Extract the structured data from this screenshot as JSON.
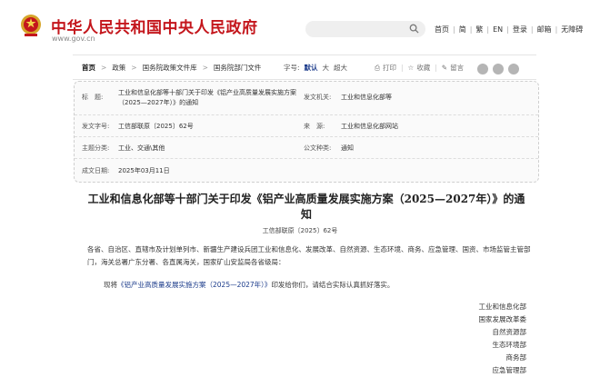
{
  "header": {
    "site_title": "中华人民共和国中央人民政府",
    "site_url": "www.gov.cn",
    "search_placeholder": "",
    "links": [
      "首页",
      "简",
      "繁",
      "EN",
      "登录",
      "邮箱",
      "无障碍"
    ]
  },
  "nav": {
    "breadcrumbs": [
      "首页",
      "政策",
      "国务院政策文件库",
      "国务院部门文件"
    ],
    "font_size_label": "字号:",
    "font_sizes": [
      "默认",
      "大",
      "超大"
    ],
    "tools": [
      "打印",
      "收藏",
      "留言"
    ]
  },
  "meta": {
    "title_label": "标　题:",
    "title_value": "工业和信息化部等十部门关于印发《铝产业高质量发展实施方案（2025—2027年）》的通知",
    "issuer_label": "发文机关:",
    "issuer_value": "工业和信息化部等",
    "doc_no_label": "发文字号:",
    "doc_no_value": "工信部联原〔2025〕62号",
    "source_label": "来　源:",
    "source_value": "工业和信息化部网站",
    "category_label": "主题分类:",
    "category_value": "工业、交通\\其他",
    "type_label": "公文种类:",
    "type_value": "通知",
    "date_label": "成文日期:",
    "date_value": "2025年03月11日"
  },
  "doc": {
    "title": "工业和信息化部等十部门关于印发《铝产业高质量发展实施方案（2025—2027年）》的通知",
    "number": "工信部联原〔2025〕62号",
    "para1": "各省、自治区、直辖市及计划单列市、新疆生产建设兵团工业和信息化、发展改革、自然资源、生态环境、商务、应急管理、国资、市场监管主管部门，海关总署广东分署、各直属海关，国家矿山安监局各省级局：",
    "para2_prefix": "现将",
    "para2_link": "《铝产业高质量发展实施方案（2025—2027年）》",
    "para2_suffix": "印发给你们，请结合实际认真抓好落实。",
    "signers": [
      "工业和信息化部",
      "国家发展改革委",
      "自然资源部",
      "生态环境部",
      "商务部",
      "应急管理部"
    ]
  },
  "colors": {
    "brand_red": "#c4161c",
    "link_blue": "#1a3a8a"
  }
}
